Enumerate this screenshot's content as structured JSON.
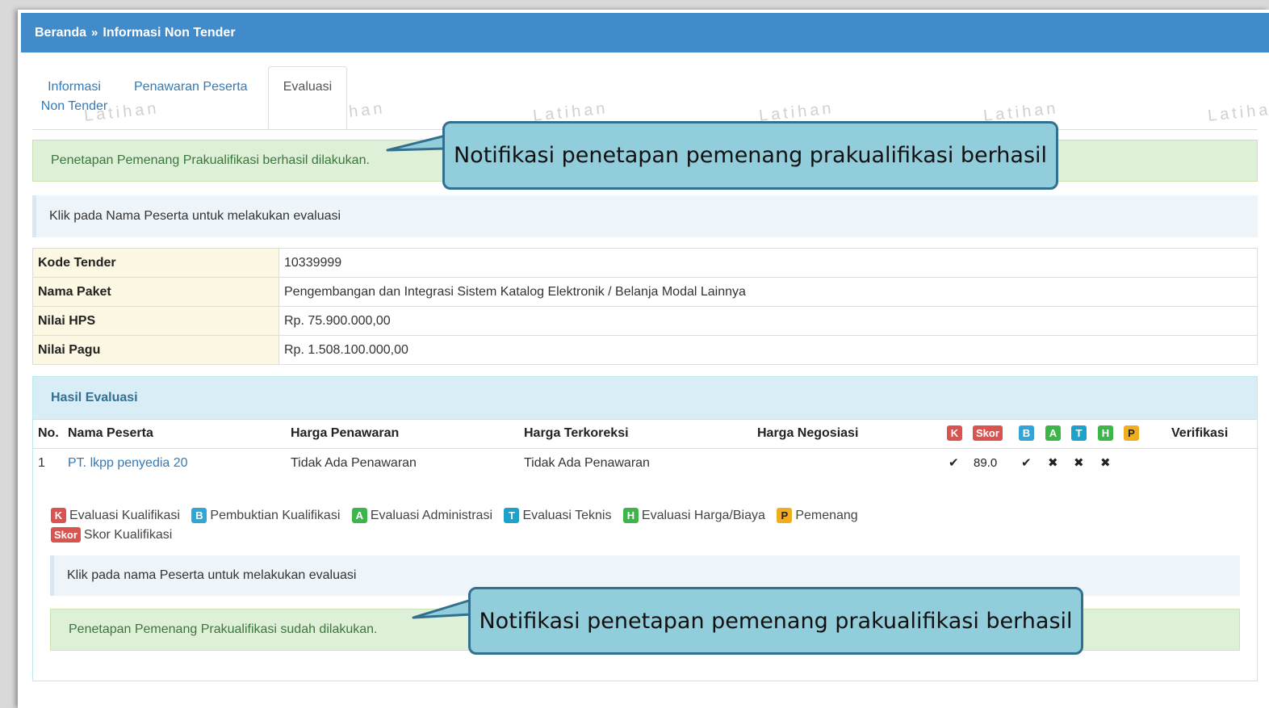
{
  "header": {
    "crumb_home": "Beranda",
    "crumb_sep": "»",
    "crumb_current": "Informasi Non Tender"
  },
  "watermark_text": "Latihan",
  "tabs": [
    {
      "label_line1": "Informasi",
      "label_line2": "Non Tender"
    },
    {
      "label": "Penawaran Peserta"
    },
    {
      "label": "Evaluasi"
    }
  ],
  "alerts": {
    "top_success": "Penetapan Pemenang Prakualifikasi berhasil dilakukan.",
    "top_info": "Klik pada Nama Peserta untuk melakukan evaluasi",
    "bottom_info": "Klik pada nama Peserta untuk melakukan evaluasi",
    "bottom_success": "Penetapan Pemenang Prakualifikasi sudah dilakukan."
  },
  "detail": [
    {
      "key": "Kode Tender",
      "value": "10339999"
    },
    {
      "key": "Nama Paket",
      "value": "Pengembangan dan Integrasi Sistem Katalog Elektronik / Belanja Modal Lainnya"
    },
    {
      "key": "Nilai HPS",
      "value": "Rp. 75.900.000,00"
    },
    {
      "key": "Nilai Pagu",
      "value": "Rp. 1.508.100.000,00"
    }
  ],
  "results": {
    "title": "Hasil Evaluasi",
    "columns": {
      "no": "No.",
      "name": "Nama Peserta",
      "offer": "Harga Penawaran",
      "corrected": "Harga Terkoreksi",
      "negotiated": "Harga Negosiasi",
      "verification": "Verifikasi"
    },
    "badges": {
      "k": "K",
      "skor": "Skor",
      "b": "B",
      "a": "A",
      "t": "T",
      "h": "H",
      "p": "P"
    },
    "rows": [
      {
        "no": "1",
        "name": "PT. lkpp penyedia 20",
        "offer": "Tidak Ada Penawaran",
        "corrected": "Tidak Ada Penawaran",
        "negotiated": "",
        "k": "✔",
        "skor": "89.0",
        "b": "✔",
        "a": "✖",
        "t": "✖",
        "h": "✖",
        "p": ""
      }
    ]
  },
  "legend": [
    {
      "badge": "K",
      "label": "Evaluasi Kualifikasi"
    },
    {
      "badge": "B",
      "label": "Pembuktian Kualifikasi"
    },
    {
      "badge": "A",
      "label": "Evaluasi Administrasi"
    },
    {
      "badge": "T",
      "label": "Evaluasi Teknis"
    },
    {
      "badge": "H",
      "label": "Evaluasi Harga/Biaya"
    },
    {
      "badge": "P",
      "label": "Pemenang"
    },
    {
      "badge": "Skor",
      "label": "Skor Kualifikasi"
    }
  ],
  "callouts": {
    "top": "Notifikasi penetapan pemenang prakualifikasi berhasil",
    "bottom": "Notifikasi penetapan pemenang prakualifikasi berhasil"
  },
  "colors": {
    "header_blue": "#428bca",
    "success_bg": "#dff0d8",
    "callout_bg": "#92cddc",
    "callout_border": "#31718f",
    "badge_red": "#d9534f",
    "badge_green": "#3cb54a",
    "badge_yellow": "#f0ad1e"
  }
}
